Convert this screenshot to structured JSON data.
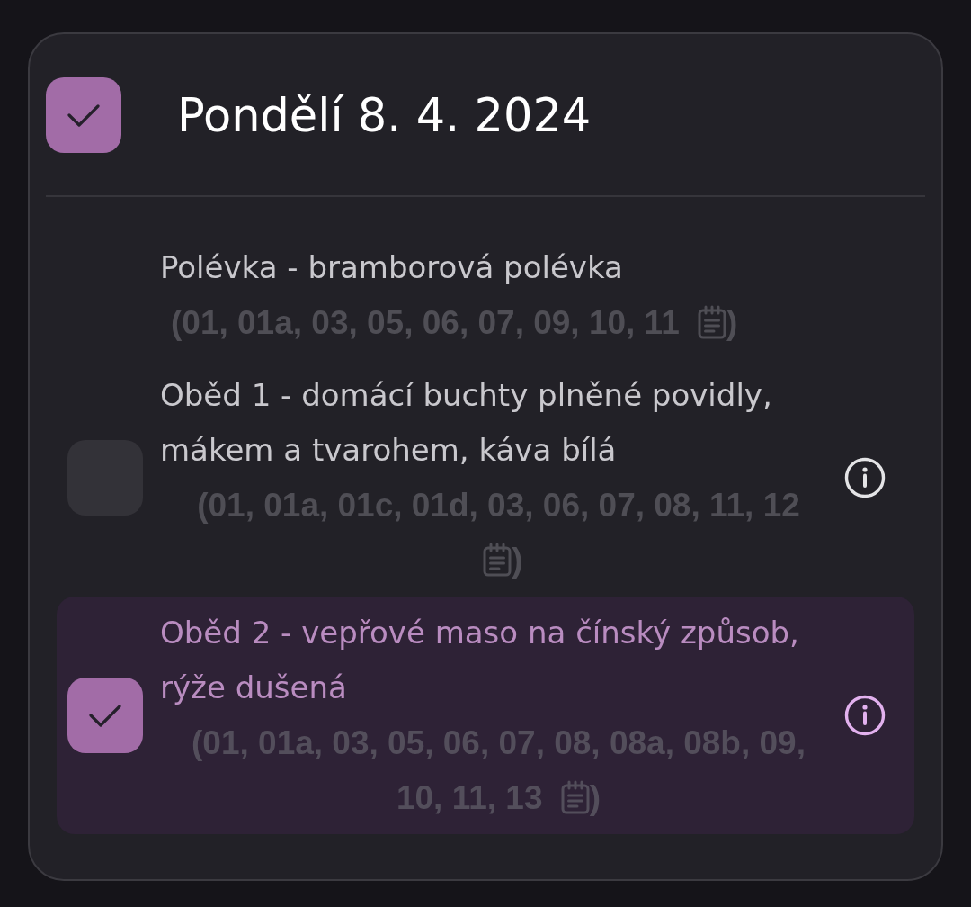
{
  "header": {
    "checked": true,
    "title": "Pondělí 8. 4. 2024"
  },
  "items": [
    {
      "kind": "soup",
      "title": "Polévka - bramborová polévka",
      "allergen_lines": [
        "(01, 01a, 03, 05, 06, 07, 09, 10, 11"
      ],
      "closing": ")"
    },
    {
      "kind": "meal",
      "checked": false,
      "title": "Oběd 1 - domácí buchty plněné povidly, mákem a tvarohem, káva bílá",
      "allergen_lines": [
        "(01, 01a, 01c, 01d, 03, 06, 07, 08, 11, 12"
      ],
      "closing": ")"
    },
    {
      "kind": "meal",
      "checked": true,
      "title": "Oběd 2 - vepřové maso na čínský způsob, rýže dušená",
      "allergen_lines": [
        "(01, 01a, 03, 05, 06, 07, 08, 08a, 08b, 09,",
        "10, 11, 13"
      ],
      "closing": ")"
    }
  ]
}
